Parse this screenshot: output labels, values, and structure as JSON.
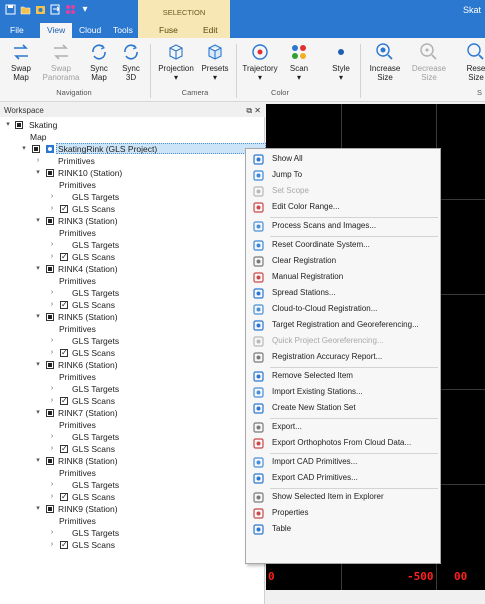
{
  "window": {
    "title_partial": "Skat"
  },
  "contextual_tab": {
    "header": "SELECTION",
    "tabs": [
      "Fuse",
      "Edit"
    ]
  },
  "tabs": [
    "File",
    "View",
    "Cloud",
    "Tools"
  ],
  "ribbon": {
    "navigation": {
      "label": "Navigation",
      "buttons": [
        {
          "label": "Swap\nMap",
          "name": "swap-map"
        },
        {
          "label": "Swap\nPanorama",
          "name": "swap-panorama",
          "disabled": true
        },
        {
          "label": "Sync\nMap",
          "name": "sync-map"
        },
        {
          "label": "Sync\n3D",
          "name": "sync-3d"
        }
      ]
    },
    "camera": {
      "label": "Camera",
      "buttons": [
        {
          "label": "Projection",
          "name": "projection"
        },
        {
          "label": "Presets",
          "name": "presets"
        }
      ]
    },
    "color": {
      "label": "Color",
      "buttons": [
        {
          "label": "Trajectory",
          "name": "trajectory"
        },
        {
          "label": "Scan",
          "name": "scan"
        },
        {
          "label": "Style",
          "name": "style"
        }
      ]
    },
    "size": {
      "buttons": [
        {
          "label": "Increase\nSize",
          "name": "increase-size"
        },
        {
          "label": "Decrease\nSize",
          "name": "decrease-size",
          "disabled": true
        },
        {
          "label": "Rese\nSize",
          "name": "reset-size"
        }
      ]
    },
    "partial_group_label": "S"
  },
  "workspace": {
    "title": "Workspace",
    "controls": "⧉ ✕",
    "tree": {
      "root": "Skating",
      "map": "Map",
      "project": "SkatingRink (GLS Project)",
      "primitives": "Primitives",
      "stations": [
        {
          "name": "RINK10 (Station)"
        },
        {
          "name": "RINK3 (Station)"
        },
        {
          "name": "RINK4 (Station)"
        },
        {
          "name": "RINK5 (Station)"
        },
        {
          "name": "RINK6 (Station)"
        },
        {
          "name": "RINK7 (Station)"
        },
        {
          "name": "RINK8 (Station)"
        },
        {
          "name": "RINK9 (Station)"
        }
      ],
      "child_primitives": "Primitives",
      "child_targets": "GLS Targets",
      "child_scans": "GLS Scans"
    }
  },
  "viewport": {
    "labels": [
      "0",
      "-500",
      "00"
    ]
  },
  "context_menu": [
    {
      "label": "Show All",
      "icon": "show-all-icon"
    },
    {
      "label": "Jump To",
      "icon": "jump-to-icon"
    },
    {
      "label": "Set Scope",
      "icon": "set-scope-icon",
      "disabled": true
    },
    {
      "label": "Edit Color Range...",
      "icon": "color-range-icon"
    },
    {
      "sep": true
    },
    {
      "label": "Process Scans and Images...",
      "icon": "process-scans-icon"
    },
    {
      "sep": true
    },
    {
      "label": "Reset Coordinate System...",
      "icon": "reset-coordinate-icon"
    },
    {
      "label": "Clear Registration",
      "icon": "clear-registration-icon"
    },
    {
      "label": "Manual Registration",
      "icon": "manual-registration-icon"
    },
    {
      "label": "Spread Stations...",
      "icon": "spread-stations-icon"
    },
    {
      "label": "Cloud-to-Cloud Registration...",
      "icon": "cloud-registration-icon"
    },
    {
      "label": "Target Registration and Georeferencing...",
      "icon": "target-registration-icon"
    },
    {
      "label": "Quick Project Georeferencing...",
      "icon": "georeferencing-icon",
      "disabled": true
    },
    {
      "label": "Registration Accuracy Report...",
      "icon": "accuracy-report-icon"
    },
    {
      "sep": true
    },
    {
      "label": "Remove Selected Item",
      "icon": "remove-item-icon"
    },
    {
      "label": "Import Existing Stations...",
      "icon": "import-stations-icon"
    },
    {
      "label": "Create New Station Set",
      "icon": "station-set-icon"
    },
    {
      "sep": true
    },
    {
      "label": "Export...",
      "icon": "export-icon"
    },
    {
      "label": "Export Orthophotos From Cloud Data...",
      "icon": "orthophoto-icon"
    },
    {
      "sep": true
    },
    {
      "label": "Import CAD Primitives...",
      "icon": "import-cad-icon"
    },
    {
      "label": "Export CAD Primitives...",
      "icon": "export-cad-icon"
    },
    {
      "sep": true
    },
    {
      "label": "Show Selected Item in Explorer",
      "icon": "explorer-icon"
    },
    {
      "label": "Properties",
      "icon": "properties-icon"
    },
    {
      "label": "Table",
      "icon": "table-icon"
    }
  ],
  "colors": {
    "accent": "#2b78d0",
    "contextual": "#f7e7b5",
    "selection": "#cce4f7",
    "viewport_label": "#ff2020"
  }
}
